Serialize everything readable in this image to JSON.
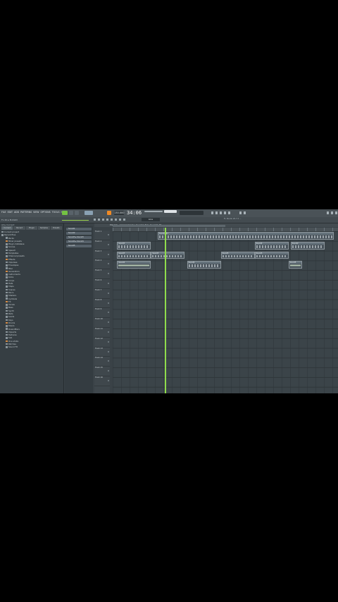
{
  "topbar": {
    "menu": [
      "FILE",
      "EDIT",
      "ADD",
      "PATTERNS",
      "VIEW",
      "OPTIONS",
      "TOOLS",
      "HELP"
    ],
    "pattern_label": "PAT",
    "song_label": "SONG",
    "bpm": "130.000",
    "time_display": "34:06",
    "time_suffix": ":00"
  },
  "toolbar2": {
    "hint": "FL 20 ▸ PLUGIN",
    "snap": "Line",
    "right_info": "FL Studio 20.7.2 ..."
  },
  "browser": {
    "header": "All ▸ Current",
    "tabs": [
      "Current",
      "Recent",
      "Plugin",
      "Samples",
      "Presets"
    ],
    "items": [
      {
        "label": "Current project",
        "style": "normal"
      },
      {
        "label": "Recent files",
        "style": "normal"
      },
      {
        "label": "Packs",
        "style": "normal"
      },
      {
        "label": "Mixer presets",
        "style": "orange"
      },
      {
        "label": "Plugin database",
        "style": "normal"
      },
      {
        "label": "Scores",
        "style": "normal"
      },
      {
        "label": "Speech",
        "style": "normal"
      },
      {
        "label": "Templates",
        "style": "normal"
      },
      {
        "label": "Channel presets",
        "style": "normal"
      },
      {
        "label": "Effects",
        "style": "orange"
      },
      {
        "label": "Impulses",
        "style": "normal"
      },
      {
        "label": "Envelopes",
        "style": "normal"
      },
      {
        "label": "Misc",
        "style": "normal"
      },
      {
        "label": "Generators",
        "style": "orange"
      },
      {
        "label": "Instruments",
        "style": "normal"
      },
      {
        "label": "Kicks",
        "style": "normal"
      },
      {
        "label": "Loops",
        "style": "normal"
      },
      {
        "label": "Hats",
        "style": "normal"
      },
      {
        "label": "Claps",
        "style": "normal"
      },
      {
        "label": "Snares",
        "style": "normal"
      },
      {
        "label": "Percs",
        "style": "normal"
      },
      {
        "label": "Shakers",
        "style": "normal"
      },
      {
        "label": "Cymbals",
        "style": "normal"
      },
      {
        "label": "FX",
        "style": "orange"
      },
      {
        "label": "Vocals",
        "style": "normal"
      },
      {
        "label": "Bass",
        "style": "normal"
      },
      {
        "label": "Synth",
        "style": "normal"
      },
      {
        "label": "Pads",
        "style": "normal"
      },
      {
        "label": "Leads",
        "style": "normal"
      },
      {
        "label": "Keys",
        "style": "normal"
      },
      {
        "label": "Drums",
        "style": "orange"
      },
      {
        "label": "Risers",
        "style": "normal"
      },
      {
        "label": "Downlifters",
        "style": "normal"
      },
      {
        "label": "Impacts",
        "style": "normal"
      },
      {
        "label": "Textures",
        "style": "normal"
      },
      {
        "label": "Sub",
        "style": "normal"
      },
      {
        "label": "One shots",
        "style": "orange"
      },
      {
        "label": "Patches",
        "style": "normal"
      },
      {
        "label": "Sound FX",
        "style": "normal"
      }
    ]
  },
  "channels": [
    "Sound1",
    "Sound2",
    "Sound3 ▸ Sound3",
    "Sound4 ▸ Sound4",
    "Sound5"
  ],
  "playlist": {
    "title": "Playlist - Arrangement ▸ Sound1 #2 ▸ Sound1 #1",
    "tracks": [
      "Track 1",
      "Track 2",
      "Track 3",
      "Track 4",
      "Track 5",
      "Track 6",
      "Track 7",
      "Track 8",
      "Track 9",
      "Track 10",
      "Track 11",
      "Track 12",
      "Track 13",
      "Track 14",
      "Track 15",
      "Track 16"
    ],
    "clips": [
      {
        "label": "Sound1 #1",
        "track": 0,
        "start": 0.2,
        "len": 0.78,
        "kind": "notes"
      },
      {
        "label": "Sound2",
        "track": 1,
        "start": 0.02,
        "len": 0.15,
        "kind": "notes"
      },
      {
        "label": "Sound2",
        "track": 1,
        "start": 0.63,
        "len": 0.15,
        "kind": "notes"
      },
      {
        "label": "Sound2",
        "track": 1,
        "start": 0.79,
        "len": 0.15,
        "kind": "notes"
      },
      {
        "label": "Sound3",
        "track": 2,
        "start": 0.02,
        "len": 0.15,
        "kind": "notes"
      },
      {
        "label": "Sound3",
        "track": 2,
        "start": 0.17,
        "len": 0.15,
        "kind": "notes"
      },
      {
        "label": "Sound3",
        "track": 2,
        "start": 0.48,
        "len": 0.15,
        "kind": "notes"
      },
      {
        "label": "Sound3",
        "track": 2,
        "start": 0.63,
        "len": 0.15,
        "kind": "notes"
      },
      {
        "label": "Sound4",
        "track": 3,
        "start": 0.02,
        "len": 0.15,
        "kind": "wave"
      },
      {
        "label": "Sound4",
        "track": 3,
        "start": 0.33,
        "len": 0.15,
        "kind": "notes"
      },
      {
        "label": "Sound5",
        "track": 3,
        "start": 0.78,
        "len": 0.06,
        "kind": "wave"
      }
    ],
    "playhead": 0.23
  }
}
